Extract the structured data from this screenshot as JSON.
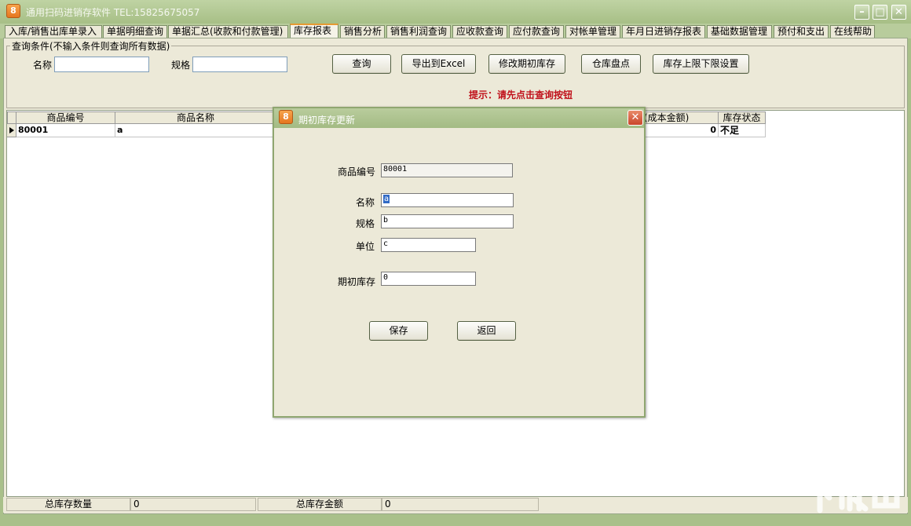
{
  "window": {
    "app_icon": "app-logo-icon",
    "title": "通用扫码进销存软件 TEL:15825675057",
    "controls": [
      "minimize-icon",
      "maximize-icon",
      "close-icon"
    ]
  },
  "tabs": [
    "入库/销售出库单录入",
    "单据明细查询",
    "单据汇总(收款和付款管理)",
    "库存报表",
    "销售分析",
    "销售利润查询",
    "应收款查询",
    "应付款查询",
    "对帐单管理",
    "年月日进销存报表",
    "基础数据管理",
    "预付和支出",
    "在线帮助"
  ],
  "active_tab": "库存报表",
  "query": {
    "group_label": "查询条件(不输入条件则查询所有数据)",
    "name_label": "名称",
    "name_value": "",
    "spec_label": "规格",
    "spec_value": "",
    "buttons": [
      "查询",
      "导出到Excel",
      "修改期初库存",
      "仓库盘点",
      "库存上限下限设置"
    ],
    "hint": "提示：请先点击查询按钮"
  },
  "grid": {
    "columns": [
      "商品编号",
      "商品名称",
      "(成本金额)",
      "库存状态"
    ],
    "rows": [
      {
        "code": "80001",
        "name": "a",
        "cost": "0",
        "status": "不足"
      }
    ]
  },
  "status_bar": {
    "qty_label": "总库存数量",
    "qty_value": "0",
    "amount_label": "总库存金额",
    "amount_value": "0"
  },
  "dialog": {
    "title": "期初库存更新",
    "code_label": "商品编号",
    "code_value": "80001",
    "name_label": "名称",
    "name_value": "a",
    "spec_label": "规格",
    "spec_value": "b",
    "unit_label": "单位",
    "unit_value": "c",
    "opening_label": "期初库存",
    "opening_value": "0",
    "save_label": "保存",
    "back_label": "返回"
  },
  "watermark": "下载吧"
}
